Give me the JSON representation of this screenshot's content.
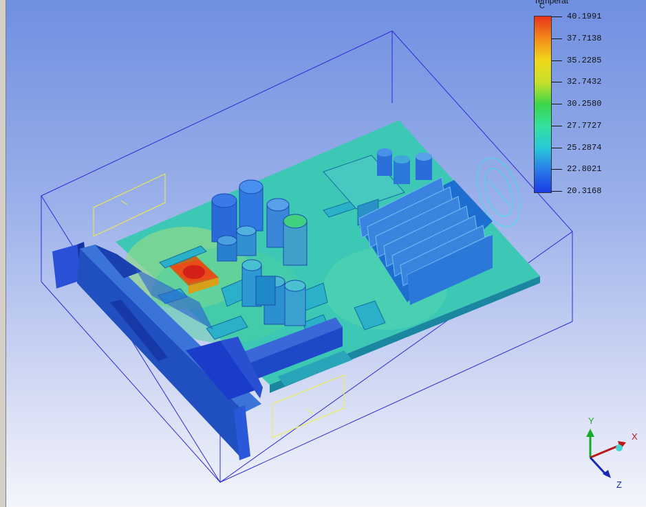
{
  "legend": {
    "title": "Temperat",
    "unit": "C",
    "ticks": [
      "40.1991",
      "37.7138",
      "35.2285",
      "32.7432",
      "30.2580",
      "27.7727",
      "25.2874",
      "22.8021",
      "20.3168"
    ]
  },
  "triad": {
    "x_label": "X",
    "y_label": "Y",
    "z_label": "Z"
  },
  "colors": {
    "hot": "#e8331b",
    "warm": "#f28a1a",
    "cool": "#28c8d8",
    "cold": "#1a3ce6",
    "enclosure_line": "#2b2bd8",
    "vent_line": "#f0f040"
  }
}
